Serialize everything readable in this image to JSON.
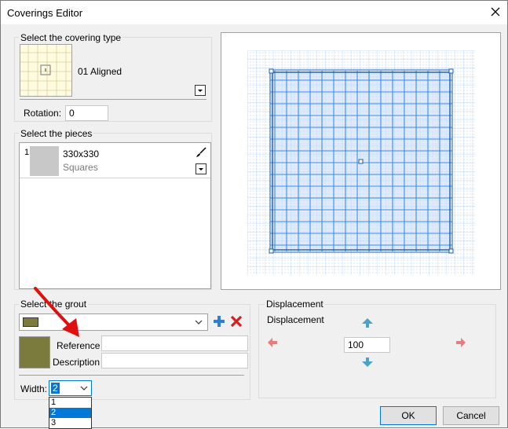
{
  "window": {
    "title": "Coverings Editor"
  },
  "covering_type": {
    "group_label": "Select the covering type",
    "name": "01 Aligned",
    "rotation_label": "Rotation:",
    "rotation_value": "0"
  },
  "pieces": {
    "group_label": "Select the pieces",
    "items": [
      {
        "index": "1",
        "size": "330x330",
        "shape": "Squares"
      }
    ]
  },
  "grout": {
    "group_label": "Select the grout",
    "color": "#7b7b3e",
    "reference_label": "Reference",
    "reference_value": "",
    "description_label": "Description",
    "description_value": "",
    "width_label": "Width:",
    "width_value": "2",
    "width_options": [
      "1",
      "2",
      "3"
    ],
    "width_selected_index": 1
  },
  "displacement": {
    "group_label": "Displacement",
    "label": "Displacement",
    "value": "100"
  },
  "buttons": {
    "ok": "OK",
    "cancel": "Cancel"
  },
  "colors": {
    "accent": "#0078d7",
    "grid_blue": "#3c8ee6",
    "arrow_green_blue": "#4aa3c8",
    "arrow_red": "#e87c7c",
    "delete_red": "#d42020",
    "add_blue": "#2d7fd3"
  }
}
